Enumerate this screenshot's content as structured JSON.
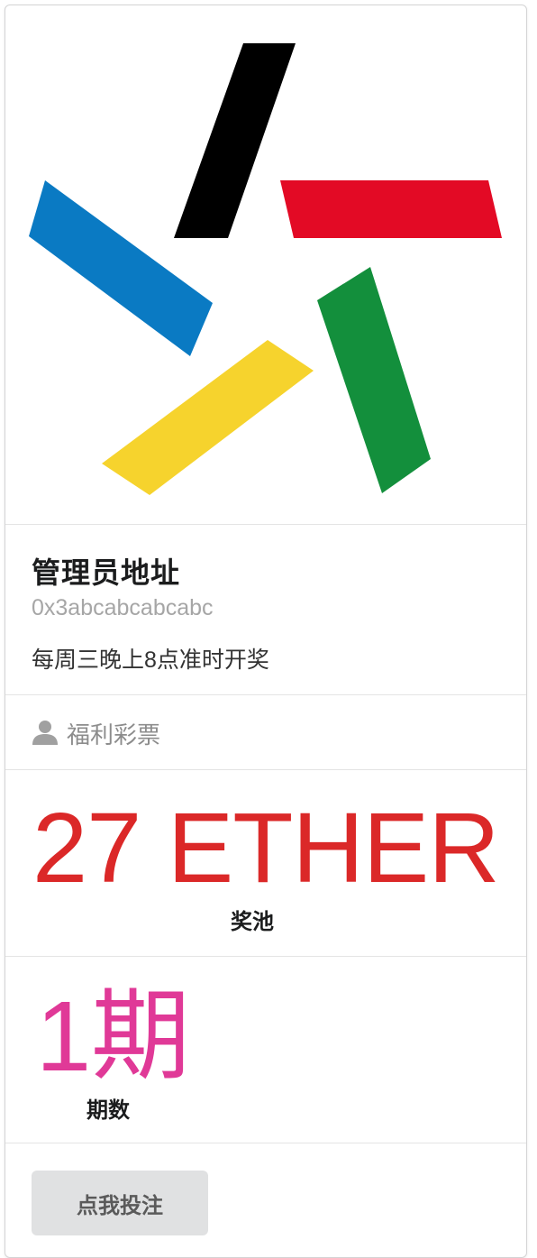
{
  "card": {
    "header": "管理员地址",
    "meta": "0x3abcabcabcabc",
    "description": "每周三晚上8点准时开奖",
    "extra": {
      "icon": "user-icon",
      "label": "福利彩票"
    },
    "stats": {
      "pool": {
        "value": "27 ETHER",
        "label": "奖池",
        "color": "#db2828"
      },
      "round": {
        "value": "1期",
        "label": "期数",
        "color": "#e03997"
      }
    },
    "button_label": "点我投注"
  },
  "logo": {
    "icon": "five-stroke-star-logo",
    "colors": [
      "#000000",
      "#e30a25",
      "#0a7ac3",
      "#f6d32d",
      "#138f3c"
    ]
  }
}
